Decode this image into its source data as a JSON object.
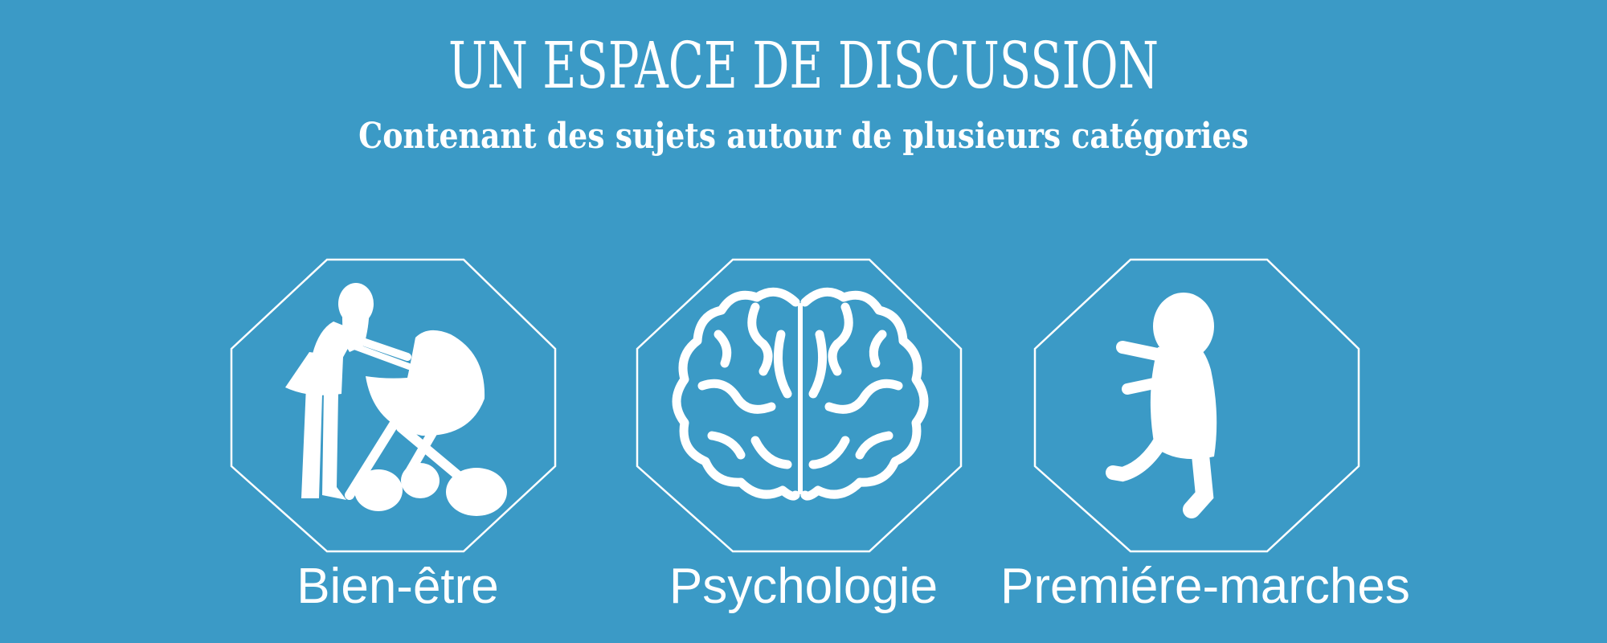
{
  "banner": {
    "title": "UN ESPACE DE DISCUSSION",
    "subtitle": "Contenant des sujets autour de plusieurs catégories"
  },
  "categories": [
    {
      "label": "Bien-être",
      "icon": "mother-with-stroller-icon"
    },
    {
      "label": "Psychologie",
      "icon": "brain-icon"
    },
    {
      "label": "Premiére-marches",
      "icon": "toddler-walking-icon"
    }
  ],
  "colors": {
    "background": "#3b9ac6",
    "foreground": "#ffffff"
  }
}
